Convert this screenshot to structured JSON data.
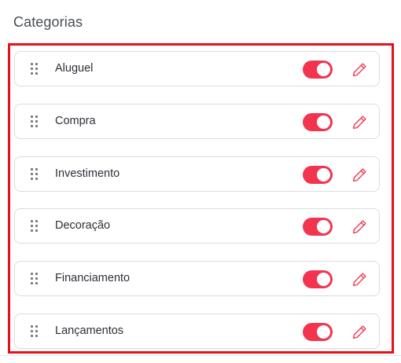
{
  "section": {
    "title": "Categorias"
  },
  "colors": {
    "accent": "#f2344f",
    "highlight": "#e4101a"
  },
  "categories": [
    {
      "label": "Aluguel",
      "enabled": true,
      "drag_icon": "drag-handle-icon",
      "edit_icon": "pencil-icon"
    },
    {
      "label": "Compra",
      "enabled": true,
      "drag_icon": "drag-handle-icon",
      "edit_icon": "pencil-icon"
    },
    {
      "label": "Investimento",
      "enabled": true,
      "drag_icon": "drag-handle-icon",
      "edit_icon": "pencil-icon"
    },
    {
      "label": "Decoração",
      "enabled": true,
      "drag_icon": "drag-handle-icon",
      "edit_icon": "pencil-icon"
    },
    {
      "label": "Financiamento",
      "enabled": true,
      "drag_icon": "drag-handle-icon",
      "edit_icon": "pencil-icon"
    },
    {
      "label": "Lançamentos",
      "enabled": true,
      "drag_icon": "drag-handle-icon",
      "edit_icon": "pencil-icon"
    }
  ]
}
